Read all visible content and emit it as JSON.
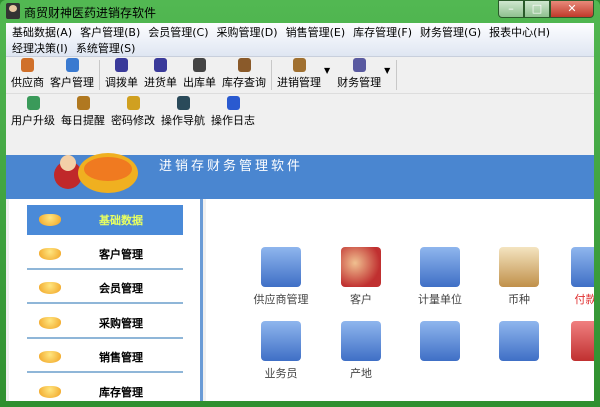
{
  "window": {
    "title": "商贸财神医药进销存软件",
    "min": "–",
    "max": "□",
    "close": "✕"
  },
  "menu": [
    "基础数据(A)",
    "客户管理(B)",
    "会员管理(C)",
    "采购管理(D)",
    "销售管理(E)",
    "库存管理(F)",
    "财务管理(G)",
    "报表中心(H)",
    "经理决策(I)",
    "系统管理(S)"
  ],
  "toolbar1": [
    {
      "label": "供应商",
      "icon": "supplier-icon",
      "color": "#d0702a"
    },
    {
      "label": "客户管理",
      "icon": "customer-globe-icon",
      "color": "#3a7ad0"
    },
    {
      "label": "调拨单",
      "icon": "transfer-battery-icon",
      "color": "#3a3a9a"
    },
    {
      "label": "进货单",
      "icon": "purchase-battery-icon",
      "color": "#3a3a9a"
    },
    {
      "label": "出库单",
      "icon": "clipboard-icon",
      "color": "#444"
    },
    {
      "label": "库存查询",
      "icon": "inventory-icon",
      "color": "#8a5a2a"
    },
    {
      "label": "进销管理",
      "icon": "box-icon",
      "color": "#a07030"
    },
    {
      "label": "财务管理",
      "icon": "trash-icon",
      "color": "#5a5aa0"
    }
  ],
  "toolbar2": [
    {
      "label": "用户升级",
      "icon": "globe-icon",
      "color": "#3a9a5a"
    },
    {
      "label": "每日提醒",
      "icon": "reminder-icon",
      "color": "#b07820"
    },
    {
      "label": "密码修改",
      "icon": "lock-icon",
      "color": "#d0a020"
    },
    {
      "label": "操作导航",
      "icon": "bag-icon",
      "color": "#2a4a5a"
    },
    {
      "label": "操作日志",
      "icon": "floppy-icon",
      "color": "#2a5ad0"
    }
  ],
  "banner": {
    "slogan": "进销存财务管理软件"
  },
  "sidebar": [
    "基础数据",
    "客户管理",
    "会员管理",
    "采购管理",
    "销售管理",
    "库存管理"
  ],
  "content": [
    {
      "label": "供应商管理",
      "color": "#444"
    },
    {
      "label": "客户",
      "color": "#444"
    },
    {
      "label": "计量单位",
      "color": "#444"
    },
    {
      "label": "币种",
      "color": "#444"
    },
    {
      "label": "付款方",
      "color": "#e03030"
    },
    {
      "label": "业务员",
      "color": "#444"
    },
    {
      "label": "产地",
      "color": "#444"
    },
    {
      "label": "",
      "color": "#444"
    },
    {
      "label": "",
      "color": "#444"
    },
    {
      "label": "",
      "color": "#444"
    }
  ]
}
